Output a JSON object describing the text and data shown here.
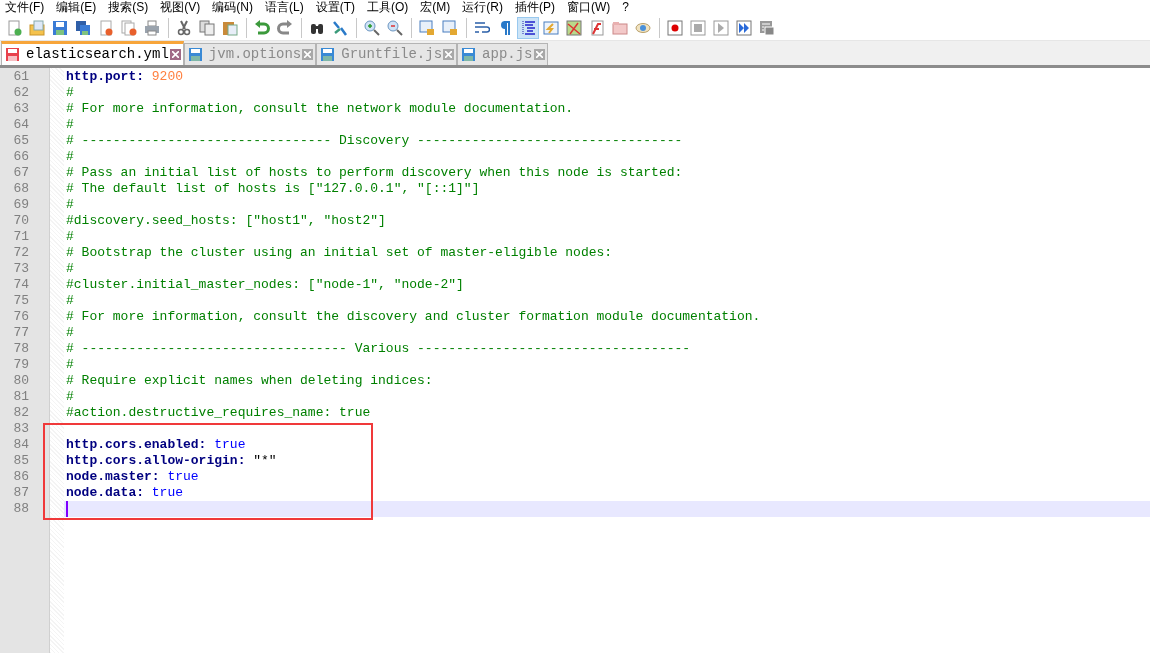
{
  "menu": [
    "文件(F)",
    "编辑(E)",
    "搜索(S)",
    "视图(V)",
    "编码(N)",
    "语言(L)",
    "设置(T)",
    "工具(O)",
    "宏(M)",
    "运行(R)",
    "插件(P)",
    "窗口(W)",
    "?"
  ],
  "toolbar": [
    {
      "kind": "new",
      "pressed": false
    },
    {
      "kind": "open",
      "pressed": false
    },
    {
      "kind": "save",
      "pressed": false
    },
    {
      "kind": "save-all",
      "pressed": false
    },
    {
      "kind": "close",
      "pressed": false
    },
    {
      "kind": "close-all",
      "pressed": false
    },
    {
      "kind": "print",
      "pressed": false
    },
    {
      "kind": "sep"
    },
    {
      "kind": "cut",
      "pressed": false
    },
    {
      "kind": "copy",
      "pressed": false
    },
    {
      "kind": "paste",
      "pressed": false
    },
    {
      "kind": "sep"
    },
    {
      "kind": "undo",
      "pressed": false
    },
    {
      "kind": "redo",
      "pressed": false
    },
    {
      "kind": "sep"
    },
    {
      "kind": "find",
      "pressed": false
    },
    {
      "kind": "replace",
      "pressed": false
    },
    {
      "kind": "sep"
    },
    {
      "kind": "zoom-in",
      "pressed": false
    },
    {
      "kind": "zoom-out",
      "pressed": false
    },
    {
      "kind": "sep"
    },
    {
      "kind": "sync-v",
      "pressed": false
    },
    {
      "kind": "sync-h",
      "pressed": false
    },
    {
      "kind": "sep"
    },
    {
      "kind": "wrap",
      "pressed": false
    },
    {
      "kind": "all-chars",
      "pressed": false
    },
    {
      "kind": "indent-guide",
      "pressed": true
    },
    {
      "kind": "lang",
      "pressed": false
    },
    {
      "kind": "map",
      "pressed": false
    },
    {
      "kind": "func",
      "pressed": false
    },
    {
      "kind": "folder",
      "pressed": false
    },
    {
      "kind": "monitor",
      "pressed": false
    },
    {
      "kind": "sep"
    },
    {
      "kind": "record",
      "pressed": false
    },
    {
      "kind": "stop",
      "pressed": false
    },
    {
      "kind": "play",
      "pressed": false
    },
    {
      "kind": "play-multi",
      "pressed": false
    },
    {
      "kind": "save-macro",
      "pressed": false
    }
  ],
  "tabs": [
    {
      "label": "elasticsearch.yml",
      "selected": true,
      "modified": true
    },
    {
      "label": "jvm.options",
      "selected": false,
      "modified": false
    },
    {
      "label": "Gruntfile.js",
      "selected": false,
      "modified": false
    },
    {
      "label": "app.js",
      "selected": false,
      "modified": false
    }
  ],
  "editor": {
    "lines": [
      {
        "number": "61",
        "current": false,
        "segments": [
          {
            "kind": "key",
            "text": "http.port:"
          },
          {
            "kind": "number",
            "text": " 9200"
          }
        ]
      },
      {
        "number": "62",
        "current": false,
        "segments": [
          {
            "kind": "comment",
            "text": "#"
          }
        ]
      },
      {
        "number": "63",
        "current": false,
        "segments": [
          {
            "kind": "comment",
            "text": "# For more information, consult the network module documentation."
          }
        ]
      },
      {
        "number": "64",
        "current": false,
        "segments": [
          {
            "kind": "comment",
            "text": "#"
          }
        ]
      },
      {
        "number": "65",
        "current": false,
        "segments": [
          {
            "kind": "comment",
            "text": "# -------------------------------- Discovery ----------------------------------"
          }
        ]
      },
      {
        "number": "66",
        "current": false,
        "segments": [
          {
            "kind": "comment",
            "text": "#"
          }
        ]
      },
      {
        "number": "67",
        "current": false,
        "segments": [
          {
            "kind": "comment",
            "text": "# Pass an initial list of hosts to perform discovery when this node is started:"
          }
        ]
      },
      {
        "number": "68",
        "current": false,
        "segments": [
          {
            "kind": "comment",
            "text": "# The default list of hosts is [\"127.0.0.1\", \"[::1]\"]"
          }
        ]
      },
      {
        "number": "69",
        "current": false,
        "segments": [
          {
            "kind": "comment",
            "text": "#"
          }
        ]
      },
      {
        "number": "70",
        "current": false,
        "segments": [
          {
            "kind": "comment",
            "text": "#discovery.seed_hosts: [\"host1\", \"host2\"]"
          }
        ]
      },
      {
        "number": "71",
        "current": false,
        "segments": [
          {
            "kind": "comment",
            "text": "#"
          }
        ]
      },
      {
        "number": "72",
        "current": false,
        "segments": [
          {
            "kind": "comment",
            "text": "# Bootstrap the cluster using an initial set of master-eligible nodes:"
          }
        ]
      },
      {
        "number": "73",
        "current": false,
        "segments": [
          {
            "kind": "comment",
            "text": "#"
          }
        ]
      },
      {
        "number": "74",
        "current": false,
        "segments": [
          {
            "kind": "comment",
            "text": "#cluster.initial_master_nodes: [\"node-1\", \"node-2\"]"
          }
        ]
      },
      {
        "number": "75",
        "current": false,
        "segments": [
          {
            "kind": "comment",
            "text": "#"
          }
        ]
      },
      {
        "number": "76",
        "current": false,
        "segments": [
          {
            "kind": "comment",
            "text": "# For more information, consult the discovery and cluster formation module documentation."
          }
        ]
      },
      {
        "number": "77",
        "current": false,
        "segments": [
          {
            "kind": "comment",
            "text": "#"
          }
        ]
      },
      {
        "number": "78",
        "current": false,
        "segments": [
          {
            "kind": "comment",
            "text": "# ---------------------------------- Various -----------------------------------"
          }
        ]
      },
      {
        "number": "79",
        "current": false,
        "segments": [
          {
            "kind": "comment",
            "text": "#"
          }
        ]
      },
      {
        "number": "80",
        "current": false,
        "segments": [
          {
            "kind": "comment",
            "text": "# Require explicit names when deleting indices:"
          }
        ]
      },
      {
        "number": "81",
        "current": false,
        "segments": [
          {
            "kind": "comment",
            "text": "#"
          }
        ]
      },
      {
        "number": "82",
        "current": false,
        "segments": [
          {
            "kind": "comment",
            "text": "#action.destructive_requires_name: true"
          }
        ]
      },
      {
        "number": "83",
        "current": false
      },
      {
        "number": "84",
        "current": false,
        "segments": [
          {
            "kind": "key",
            "text": "http.cors.enabled:"
          },
          {
            "kind": "bool",
            "text": " true"
          }
        ]
      },
      {
        "number": "85",
        "current": false,
        "segments": [
          {
            "kind": "key",
            "text": "http.cors.allow-origin:"
          },
          {
            "kind": "string",
            "text": " \"*\""
          }
        ]
      },
      {
        "number": "86",
        "current": false,
        "segments": [
          {
            "kind": "key",
            "text": "node.master:"
          },
          {
            "kind": "bool",
            "text": " true"
          }
        ]
      },
      {
        "number": "87",
        "current": false,
        "segments": [
          {
            "kind": "key",
            "text": "node.data:"
          },
          {
            "kind": "bool",
            "text": " true"
          }
        ]
      },
      {
        "number": "88",
        "current": true
      }
    ]
  }
}
